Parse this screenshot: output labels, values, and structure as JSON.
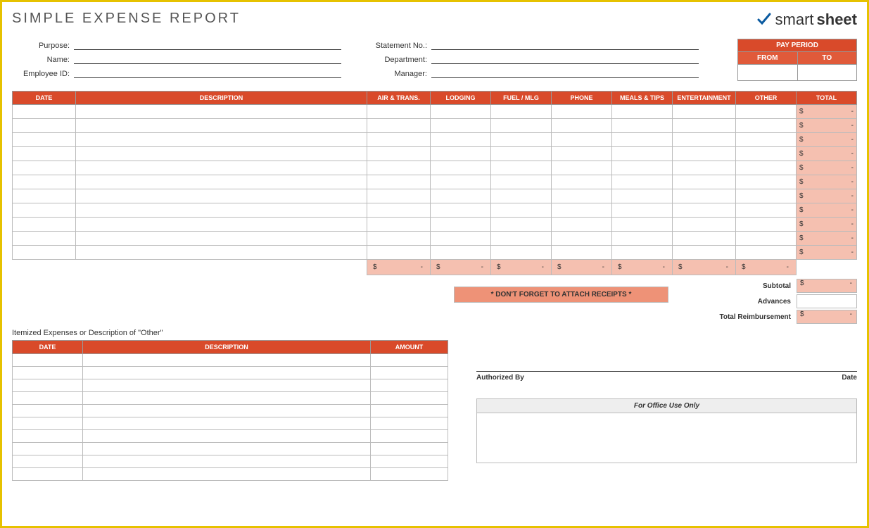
{
  "title": "SIMPLE EXPENSE REPORT",
  "brand": {
    "name_light": "smart",
    "name_bold": "sheet"
  },
  "header_fields_left": [
    {
      "label": "Purpose:"
    },
    {
      "label": "Name:"
    },
    {
      "label": "Employee ID:"
    }
  ],
  "header_fields_mid": [
    {
      "label": "Statement No.:"
    },
    {
      "label": "Department:"
    },
    {
      "label": "Manager:"
    }
  ],
  "pay_period": {
    "title": "PAY PERIOD",
    "from": "FROM",
    "to": "TO"
  },
  "main_columns": [
    "DATE",
    "DESCRIPTION",
    "AIR & TRANS.",
    "LODGING",
    "FUEL / MLG",
    "PHONE",
    "MEALS & TIPS",
    "ENTERTAINMENT",
    "OTHER",
    "TOTAL"
  ],
  "main_rows": 11,
  "currency": "$",
  "dash": "-",
  "reminder": "* DON'T FORGET TO ATTACH RECEIPTS *",
  "summary": {
    "subtotal": "Subtotal",
    "advances": "Advances",
    "total": "Total Reimbursement"
  },
  "itemized": {
    "caption": "Itemized Expenses or Description of \"Other\"",
    "columns": [
      "DATE",
      "DESCRIPTION",
      "AMOUNT"
    ],
    "rows": 10
  },
  "sign": {
    "auth": "Authorized By",
    "date": "Date",
    "office": "For Office Use Only"
  }
}
